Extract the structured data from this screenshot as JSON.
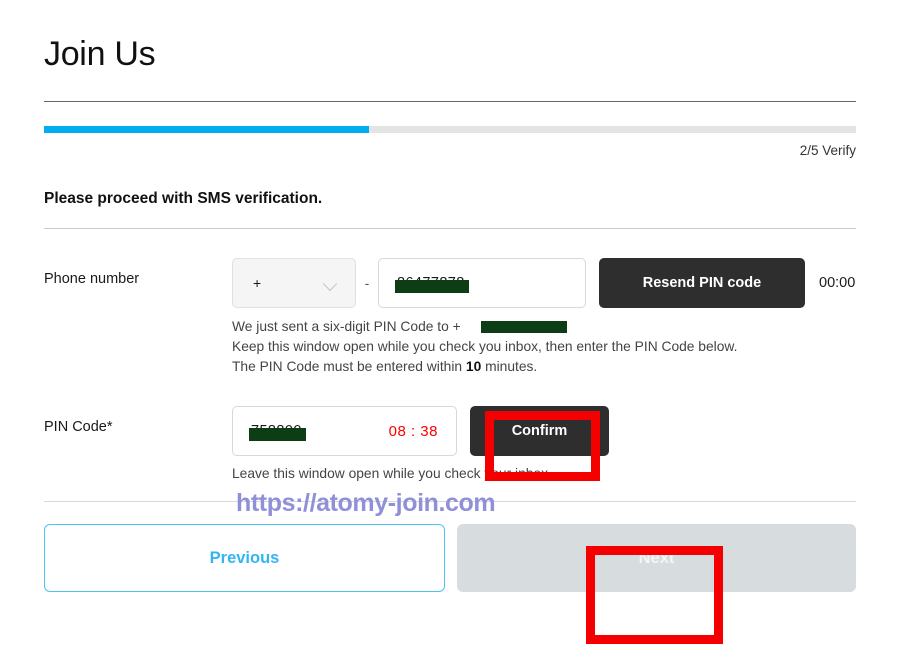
{
  "page": {
    "title": "Join Us"
  },
  "progress": {
    "percent": 40,
    "step_label": "2/5 Verify",
    "fill_color": "#00AEEF",
    "track_color": "#e4e4e4"
  },
  "section": {
    "heading": "Please proceed with SMS verification."
  },
  "phone": {
    "label": "Phone number",
    "country_code_value": "+",
    "country_code_icon": "chevron-down-icon",
    "separator": "-",
    "number_value": "86477878",
    "number_redacted": true,
    "resend_button": "Resend PIN code",
    "resend_timer": "00:00"
  },
  "info": {
    "line1_prefix": "We just sent a six-digit PIN Code to +",
    "line1_redacted_value": "",
    "line2": "Keep this window open while you check you inbox, then enter the PIN Code below.",
    "line3_prefix": "The PIN Code must be entered within ",
    "line3_bold": "10",
    "line3_suffix": " minutes."
  },
  "pin": {
    "label": "PIN Code*",
    "value": "758800",
    "value_redacted": true,
    "countdown": "08 : 38",
    "countdown_color": "#ff0000",
    "confirm_button": "Confirm",
    "help_text": "Leave this window open while you check your inbox."
  },
  "footer": {
    "previous_button": "Previous",
    "next_button": "Next",
    "next_disabled": true,
    "previous_color": "#33b5f0",
    "next_bg_color": "#d7dcdf"
  },
  "annotations": {
    "color": "#f50000",
    "boxes": [
      {
        "name": "confirm-highlight"
      },
      {
        "name": "next-highlight"
      }
    ]
  },
  "watermark": {
    "text": "https://atomy-join.com",
    "color": "#9090d8"
  }
}
